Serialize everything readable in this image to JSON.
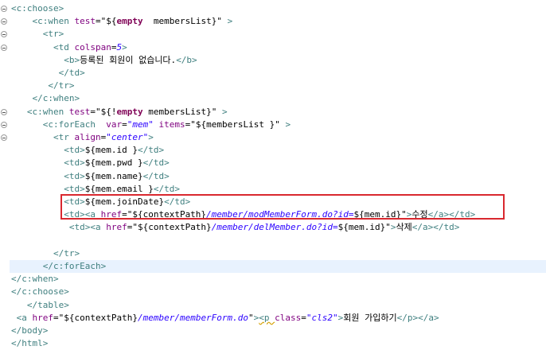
{
  "editor": {
    "lines": [
      {
        "indent": 0,
        "fold": true,
        "parts": [
          [
            "tag",
            "<c:choose>"
          ]
        ]
      },
      {
        "indent": 4,
        "fold": true,
        "parts": [
          [
            "tag",
            "<c:when "
          ],
          [
            "attr",
            "test"
          ],
          [
            "el",
            "=\""
          ],
          [
            "el",
            "${"
          ],
          [
            "kw",
            "empty"
          ],
          [
            "el",
            "  membersList}\""
          ],
          [
            "tag",
            " >"
          ]
        ]
      },
      {
        "indent": 6,
        "fold": true,
        "parts": [
          [
            "tag",
            "<tr>"
          ]
        ]
      },
      {
        "indent": 8,
        "fold": true,
        "parts": [
          [
            "tag",
            "<td "
          ],
          [
            "attr",
            "colspan"
          ],
          [
            "el",
            "="
          ],
          [
            "val",
            "5"
          ],
          [
            "tag",
            ">"
          ]
        ]
      },
      {
        "indent": 10,
        "fold": false,
        "parts": [
          [
            "tag",
            "<b>"
          ],
          [
            "txt",
            "등록된 회원이 없습니다."
          ],
          [
            "tag",
            "</b>"
          ]
        ]
      },
      {
        "indent": 9,
        "fold": false,
        "parts": [
          [
            "tag",
            "</td>"
          ]
        ]
      },
      {
        "indent": 7,
        "fold": false,
        "parts": [
          [
            "tag",
            "</tr>"
          ]
        ]
      },
      {
        "indent": 4,
        "fold": false,
        "parts": [
          [
            "tag",
            "</c:when>"
          ]
        ]
      },
      {
        "indent": 3,
        "fold": true,
        "parts": [
          [
            "tag",
            "<c:when "
          ],
          [
            "attr",
            "test"
          ],
          [
            "el",
            "=\"${!"
          ],
          [
            "kw",
            "empty"
          ],
          [
            "el",
            " membersList}\""
          ],
          [
            "tag",
            " >"
          ]
        ]
      },
      {
        "indent": 6,
        "fold": true,
        "parts": [
          [
            "tag",
            "<c:forEach  "
          ],
          [
            "attr",
            "var"
          ],
          [
            "el",
            "="
          ],
          [
            "val",
            "\"mem\""
          ],
          [
            "el",
            " "
          ],
          [
            "attr",
            "items"
          ],
          [
            "el",
            "=\"${membersList }\""
          ],
          [
            "tag",
            " >"
          ]
        ]
      },
      {
        "indent": 8,
        "fold": true,
        "parts": [
          [
            "tag",
            "<tr "
          ],
          [
            "attr",
            "align"
          ],
          [
            "el",
            "="
          ],
          [
            "val",
            "\"center\""
          ],
          [
            "tag",
            ">"
          ]
        ]
      },
      {
        "indent": 10,
        "fold": false,
        "parts": [
          [
            "tag",
            "<td>"
          ],
          [
            "el",
            "${mem.id }"
          ],
          [
            "tag",
            "</td>"
          ]
        ]
      },
      {
        "indent": 10,
        "fold": false,
        "parts": [
          [
            "tag",
            "<td>"
          ],
          [
            "el",
            "${mem.pwd }"
          ],
          [
            "tag",
            "</td>"
          ]
        ]
      },
      {
        "indent": 10,
        "fold": false,
        "parts": [
          [
            "tag",
            "<td>"
          ],
          [
            "el",
            "${mem.name}"
          ],
          [
            "tag",
            "</td>"
          ]
        ]
      },
      {
        "indent": 10,
        "fold": false,
        "parts": [
          [
            "tag",
            "<td>"
          ],
          [
            "el",
            "${mem.email }"
          ],
          [
            "tag",
            "</td>"
          ]
        ]
      },
      {
        "indent": 10,
        "fold": false,
        "parts": [
          [
            "tag",
            "<td>"
          ],
          [
            "el",
            "${mem.joinDate}"
          ],
          [
            "tag",
            "</td>"
          ]
        ]
      },
      {
        "indent": 10,
        "fold": false,
        "parts": [
          [
            "tag",
            "<td><a "
          ],
          [
            "attr",
            "href"
          ],
          [
            "el",
            "=\"${contextPath}"
          ],
          [
            "path",
            "/member/modMemberForm.do?id="
          ],
          [
            "el",
            "${mem.id}\""
          ],
          [
            "tag",
            ">"
          ],
          [
            "txt",
            "수정"
          ],
          [
            "tag",
            "</a></td>"
          ]
        ]
      },
      {
        "indent": 11,
        "fold": false,
        "parts": [
          [
            "tag",
            "<td><a "
          ],
          [
            "attr",
            "href"
          ],
          [
            "el",
            "=\"${contextPath}"
          ],
          [
            "path",
            "/member/delMember.do?id="
          ],
          [
            "el",
            "${mem.id}\""
          ],
          [
            "tag",
            ">"
          ],
          [
            "txt",
            "삭제"
          ],
          [
            "tag",
            "</a></td>"
          ]
        ]
      },
      {
        "indent": 0,
        "fold": false,
        "parts": []
      },
      {
        "indent": 8,
        "fold": false,
        "parts": [
          [
            "tag",
            "</tr>"
          ]
        ]
      },
      {
        "indent": 6,
        "fold": false,
        "hl": true,
        "parts": [
          [
            "tag",
            "</c:forEach>"
          ]
        ]
      },
      {
        "indent": 0,
        "fold": false,
        "parts": [
          [
            "tag",
            "</c:when>"
          ]
        ]
      },
      {
        "indent": 0,
        "fold": false,
        "parts": [
          [
            "tag",
            "</c:choose>"
          ]
        ]
      },
      {
        "indent": 3,
        "fold": false,
        "parts": [
          [
            "tag",
            "</table>"
          ]
        ]
      },
      {
        "indent": 1,
        "fold": false,
        "parts": [
          [
            "tag",
            "<a "
          ],
          [
            "attr",
            "href"
          ],
          [
            "el",
            "=\"${contextPath}"
          ],
          [
            "path",
            "/member/memberForm.do"
          ],
          [
            "el",
            "\""
          ],
          [
            "tag",
            ">"
          ],
          [
            "sq",
            "<p "
          ],
          [
            "attr",
            "class"
          ],
          [
            "el",
            "="
          ],
          [
            "val",
            "\"cls2\""
          ],
          [
            "tag",
            ">"
          ],
          [
            "txt",
            "회원 가입하기"
          ],
          [
            "tag",
            "</p></a>"
          ]
        ]
      },
      {
        "indent": 0,
        "fold": false,
        "parts": [
          [
            "tag",
            "</body>"
          ]
        ]
      },
      {
        "indent": 0,
        "fold": false,
        "parts": [
          [
            "tag",
            "</html>"
          ]
        ]
      }
    ]
  }
}
